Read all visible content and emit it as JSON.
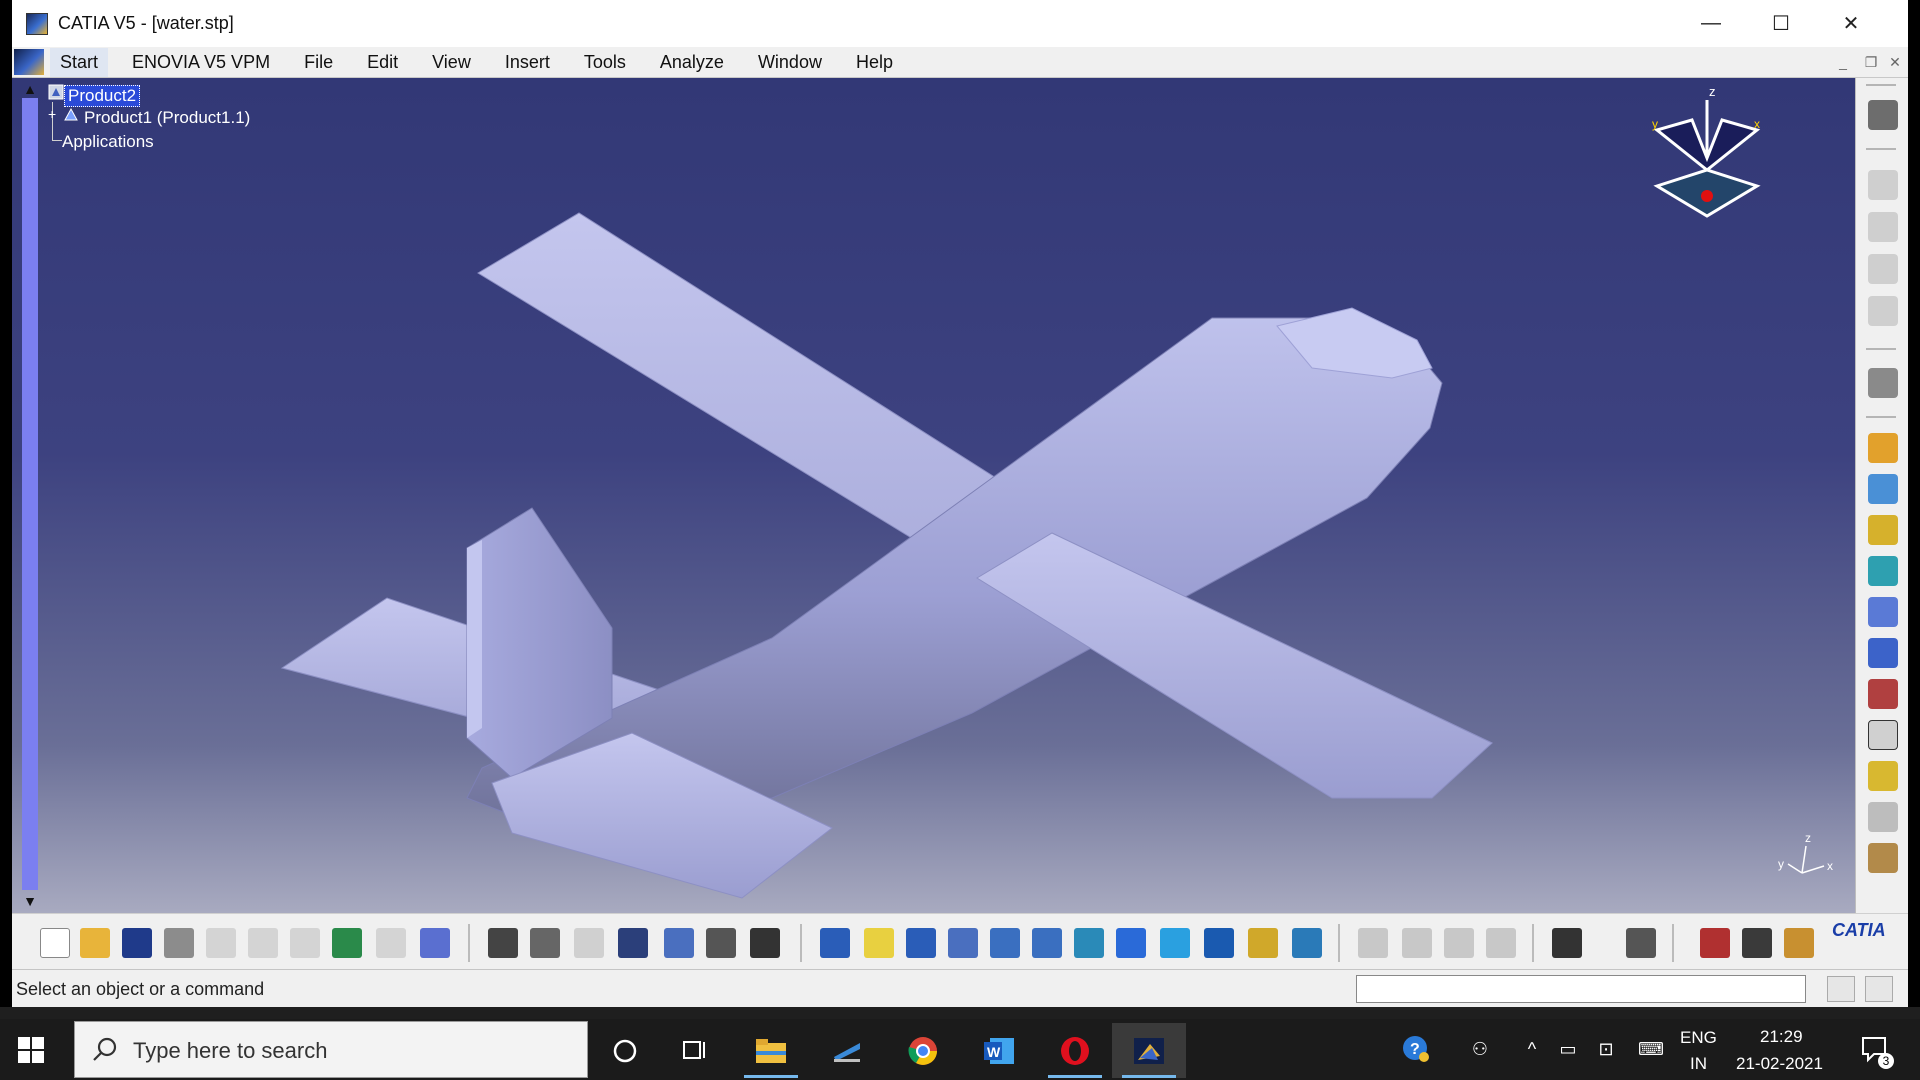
{
  "window": {
    "title": "CATIA V5 - [water.stp]",
    "controls": {
      "minimize": "—",
      "maximize": "☐",
      "close": "✕"
    }
  },
  "menubar": {
    "items": [
      "Start",
      "ENOVIA V5 VPM",
      "File",
      "Edit",
      "View",
      "Insert",
      "Tools",
      "Analyze",
      "Window",
      "Help"
    ],
    "active": "Start"
  },
  "tree": {
    "root": "Product2",
    "child": "Product1 (Product1.1)",
    "applications": "Applications"
  },
  "compass": {
    "z": "z",
    "x": "x",
    "y": "y"
  },
  "axis_triad": {
    "z": "z",
    "x": "x",
    "y": "y"
  },
  "bottom_toolbar_logo": "CATIA",
  "statusbar": {
    "message": "Select an object or a command",
    "command_input": ""
  },
  "taskbar": {
    "search_placeholder": "Type here to search",
    "language": "ENG",
    "region": "IN",
    "time": "21:29",
    "date": "21-02-2021",
    "notifications": "3"
  },
  "colors": {
    "viewport_top": "#323876",
    "viewport_bottom": "#a8aac0",
    "model": "#b5b8e6",
    "tree_selection": "#2a4ad8",
    "taskbar": "#1b1b1b"
  }
}
